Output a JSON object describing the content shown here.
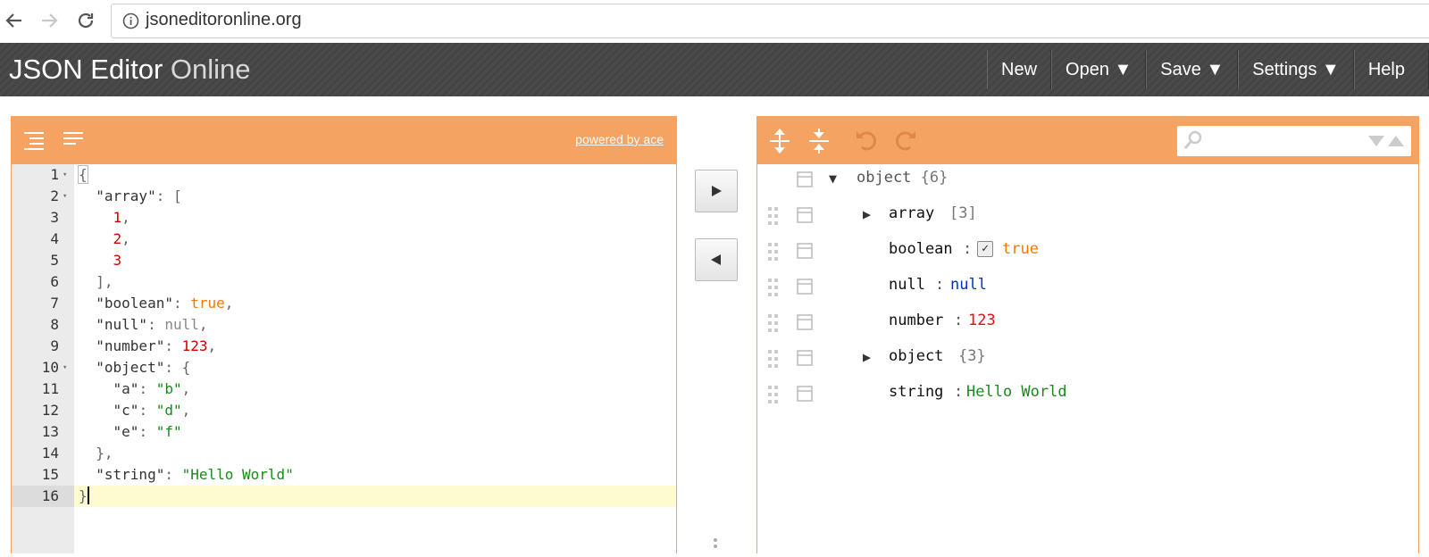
{
  "browser": {
    "url": "jsoneditoronline.org",
    "icons": [
      "back-arrow-icon",
      "forward-arrow-icon",
      "reload-icon",
      "info-icon"
    ]
  },
  "app": {
    "brand_main": "JSON Editor",
    "brand_sub": "Online",
    "menu": {
      "new": "New",
      "open": "Open ▼",
      "save": "Save ▼",
      "settings": "Settings ▼",
      "help": "Help"
    }
  },
  "code_editor": {
    "powered_by": "powered by ace",
    "lines": [
      {
        "num": "1",
        "fold": "▾"
      },
      {
        "num": "2",
        "fold": "▾"
      },
      {
        "num": "3",
        "fold": ""
      },
      {
        "num": "4",
        "fold": ""
      },
      {
        "num": "5",
        "fold": ""
      },
      {
        "num": "6",
        "fold": ""
      },
      {
        "num": "7",
        "fold": ""
      },
      {
        "num": "8",
        "fold": ""
      },
      {
        "num": "9",
        "fold": ""
      },
      {
        "num": "10",
        "fold": "▾"
      },
      {
        "num": "11",
        "fold": ""
      },
      {
        "num": "12",
        "fold": ""
      },
      {
        "num": "13",
        "fold": ""
      },
      {
        "num": "14",
        "fold": ""
      },
      {
        "num": "15",
        "fold": ""
      },
      {
        "num": "16",
        "fold": ""
      }
    ],
    "tokens": {
      "l1_brace": "{",
      "l2_key": "\"array\"",
      "l2_rest": ": [",
      "l3_num": "1",
      "l3_comma": ",",
      "l4_num": "2",
      "l4_comma": ",",
      "l5_num": "3",
      "l6_close": "],",
      "l7_key": "\"boolean\"",
      "l7_colon": ": ",
      "l7_val": "true",
      "l7_comma": ",",
      "l8_key": "\"null\"",
      "l8_colon": ": ",
      "l8_val": "null",
      "l8_comma": ",",
      "l9_key": "\"number\"",
      "l9_colon": ": ",
      "l9_val": "123",
      "l9_comma": ",",
      "l10_key": "\"object\"",
      "l10_rest": ": {",
      "l11_key": "\"a\"",
      "l11_colon": ": ",
      "l11_val": "\"b\"",
      "l11_comma": ",",
      "l12_key": "\"c\"",
      "l12_colon": ": ",
      "l12_val": "\"d\"",
      "l12_comma": ",",
      "l13_key": "\"e\"",
      "l13_colon": ": ",
      "l13_val": "\"f\"",
      "l14_close": "},",
      "l15_key": "\"string\"",
      "l15_colon": ": ",
      "l15_val": "\"Hello World\"",
      "l16_brace": "}"
    },
    "active_line": 16
  },
  "tree_editor": {
    "root": {
      "label": "object",
      "count": "{6}",
      "expanded": true
    },
    "rows": [
      {
        "field": "array",
        "count": "[3]",
        "type": "array",
        "expandable": true
      },
      {
        "field": "boolean",
        "sep": ":",
        "value": "true",
        "type": "boolean",
        "checked": true
      },
      {
        "field": "null",
        "sep": ":",
        "value": "null",
        "type": "null"
      },
      {
        "field": "number",
        "sep": ":",
        "value": "123",
        "type": "number"
      },
      {
        "field": "object",
        "count": "{3}",
        "type": "object",
        "expandable": true
      },
      {
        "field": "string",
        "sep": ":",
        "value": "Hello World",
        "type": "string"
      }
    ],
    "colors": {
      "string": "#1a8a1a",
      "number": "#e01010",
      "boolean": "#f57900",
      "null": "#0033cc"
    }
  },
  "colors": {
    "accent": "#f4a363",
    "header_bg": "#444444"
  }
}
